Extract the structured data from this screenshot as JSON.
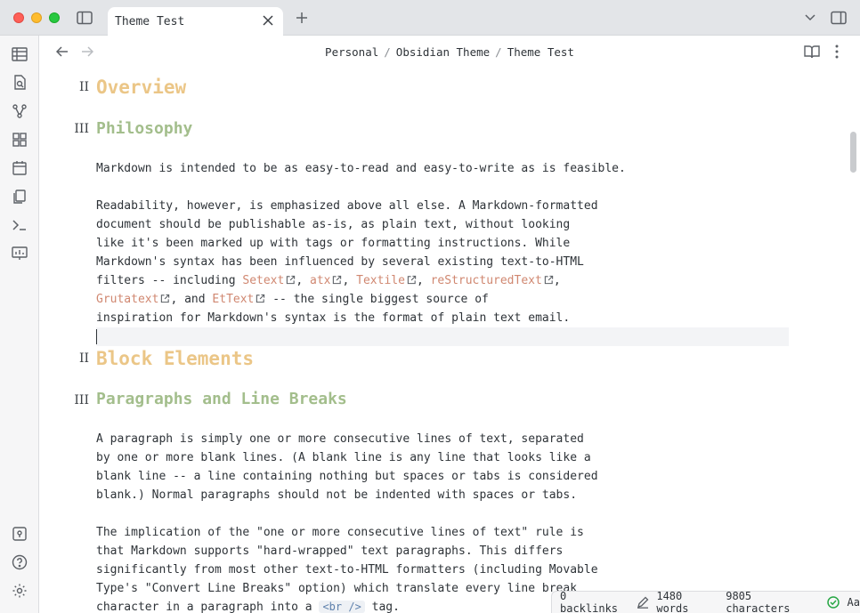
{
  "window": {
    "tab_title": "Theme Test"
  },
  "breadcrumb": {
    "parts": [
      "Personal",
      "Obsidian Theme",
      "Theme Test"
    ],
    "separator": "/"
  },
  "colors": {
    "h2": "#ebc687",
    "h3": "#a3be8c",
    "link": "#d08770",
    "code": "#5e81ac"
  },
  "document": {
    "h_overview": {
      "level_marker": "II",
      "text": "Overview"
    },
    "h_philosophy": {
      "level_marker": "III",
      "text": "Philosophy"
    },
    "p1": "Markdown is intended to be as easy-to-read and easy-to-write as is feasible.",
    "p2": {
      "line1": "Readability, however, is emphasized above all else. A Markdown-formatted",
      "line2": "document should be publishable as-is, as plain text, without looking",
      "line3": "like it's been marked up with tags or formatting instructions. While",
      "line4": "Markdown's syntax has been influenced by several existing text-to-HTML",
      "line5_pre": "filters -- including ",
      "link_setext": "Setext",
      "link_atx": "atx",
      "link_textile": "Textile",
      "link_rst": "reStructuredText",
      "link_grutatext": "Grutatext",
      "and": ", and ",
      "link_ettext": "EtText",
      "line6_post": " -- the single biggest source of",
      "line7": "inspiration for Markdown's syntax is the format of plain text email."
    },
    "h_block": {
      "level_marker": "II",
      "text": "Block Elements"
    },
    "h_paragraphs": {
      "level_marker": "III",
      "text": "Paragraphs and Line Breaks"
    },
    "p3": {
      "line1": "A paragraph is simply one or more consecutive lines of text, separated",
      "line2": "by one or more blank lines. (A blank line is any line that looks like a",
      "line3": "blank line -- a line containing nothing but spaces or tabs is considered",
      "line4": "blank.) Normal paragraphs should not be indented with spaces or tabs."
    },
    "p4": {
      "line1": "The implication of the \"one or more consecutive lines of text\" rule is",
      "line2": "that Markdown supports \"hard-wrapped\" text paragraphs. This differs",
      "line3": "significantly from most other text-to-HTML formatters (including Movable",
      "line4": "Type's \"Convert Line Breaks\" option) which translate every line break",
      "line5_pre": "character in a paragraph into a ",
      "code": "<br />",
      "line5_post": " tag."
    }
  },
  "status": {
    "backlinks": "0 backlinks",
    "words": "1480 words",
    "characters": "9805 characters",
    "font_toggle": "Aa"
  }
}
